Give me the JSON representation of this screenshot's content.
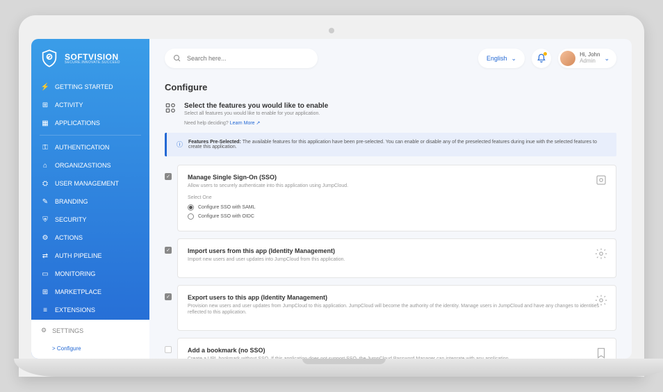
{
  "brand": {
    "name": "SOFTVISION",
    "tagline": "SECURE.INNOVATE.SUCCEED"
  },
  "search": {
    "placeholder": "Search here..."
  },
  "topbar": {
    "language": "English",
    "greeting": "Hi, John",
    "role": "Admin"
  },
  "sidebar": {
    "items": [
      {
        "icon": "⚡",
        "label": "GETTING STARTED"
      },
      {
        "icon": "⊞",
        "label": "ACTIVITY"
      },
      {
        "icon": "▦",
        "label": "APPLICATIONS"
      }
    ],
    "items2": [
      {
        "icon": "⚿",
        "label": "AUTHENTICATION"
      },
      {
        "icon": "⌂",
        "label": "ORGANIZASTIONS"
      },
      {
        "icon": "⛭",
        "label": "USER MANAGEMENT"
      },
      {
        "icon": "✎",
        "label": "BRANDING"
      },
      {
        "icon": "⛨",
        "label": "SECURITY"
      },
      {
        "icon": "⚙",
        "label": "ACTIONS"
      },
      {
        "icon": "⇄",
        "label": "AUTH PIPELINE"
      },
      {
        "icon": "▭",
        "label": "MONITORING"
      },
      {
        "icon": "⊞",
        "label": "MARKETPLACE"
      },
      {
        "icon": "≡",
        "label": "EXTENSIONS"
      }
    ],
    "settings": {
      "label": "SETTINGS",
      "sub": "Configure"
    }
  },
  "page": {
    "title": "Configure",
    "intro_title": "Select the features you would like to enable",
    "intro_sub": "Select all features you would like to enable for your application.",
    "help_text": "Need help deciding?",
    "help_link": "Learn More ↗",
    "infobox_bold": "Features Pre-Selected:",
    "infobox_text": "The available features for this application have been pre-selected. You can enable or disable any of the preselected features during inue with the selected features to create this application."
  },
  "features": [
    {
      "checked": true,
      "title": "Manage Single Sign-On (SSO)",
      "desc": "Allow users to securely authenticate into this application using JumpCloud.",
      "select_label": "Select One",
      "options": [
        {
          "label": "Configure SSO with SAML",
          "selected": true
        },
        {
          "label": "Configure SSO with OIDC",
          "selected": false
        }
      ]
    },
    {
      "checked": true,
      "title": "Import users from this app (Identity Management)",
      "desc": "Import new users and user updates into JumpCloud from this application."
    },
    {
      "checked": true,
      "title": "Export users to this app (Identity Management)",
      "desc": "Provision new users and user updates from JumpCloud to this application. JumpCloud will become the authority of the identity. Manage users in JumpCloud and have any changes to identities reflected to this application."
    },
    {
      "checked": false,
      "title": "Add a bookmark (no SSO)",
      "desc": "Create a URL bookmark without SSO. If this application does not support SSO, the JumpCloud Password Manager can integrate with any application"
    }
  ]
}
